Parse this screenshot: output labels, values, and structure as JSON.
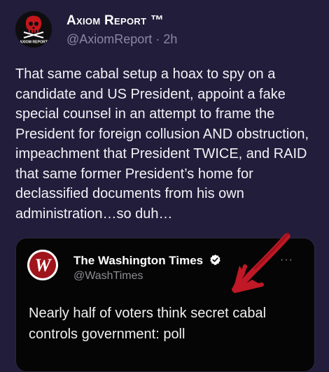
{
  "author": {
    "display_name": "Axiom Report ™",
    "handle": "@AxiomReport",
    "separator": "·",
    "time": "2h",
    "avatar_text": "AXIOM REPORT"
  },
  "tweet": {
    "text": "That same cabal setup a hoax to spy on a candidate and US President, appoint a fake special counsel in an attempt to frame the President for foreign collusion AND obstruction, impeachment that President TWICE, and RAID that same former President’s home for declassified documents from his own administration…so duh…"
  },
  "quoted": {
    "display_name": "The Washington Times",
    "handle": "@WashTimes",
    "text": "Nearly half of voters think secret cabal controls government: poll",
    "verified": true,
    "more_label": "···"
  },
  "colors": {
    "background": "#221d3a",
    "secondary_text": "#8c87a6",
    "card_background": "#050505",
    "annotation_arrow": "#c01826",
    "verified_badge": "#ffffff"
  }
}
